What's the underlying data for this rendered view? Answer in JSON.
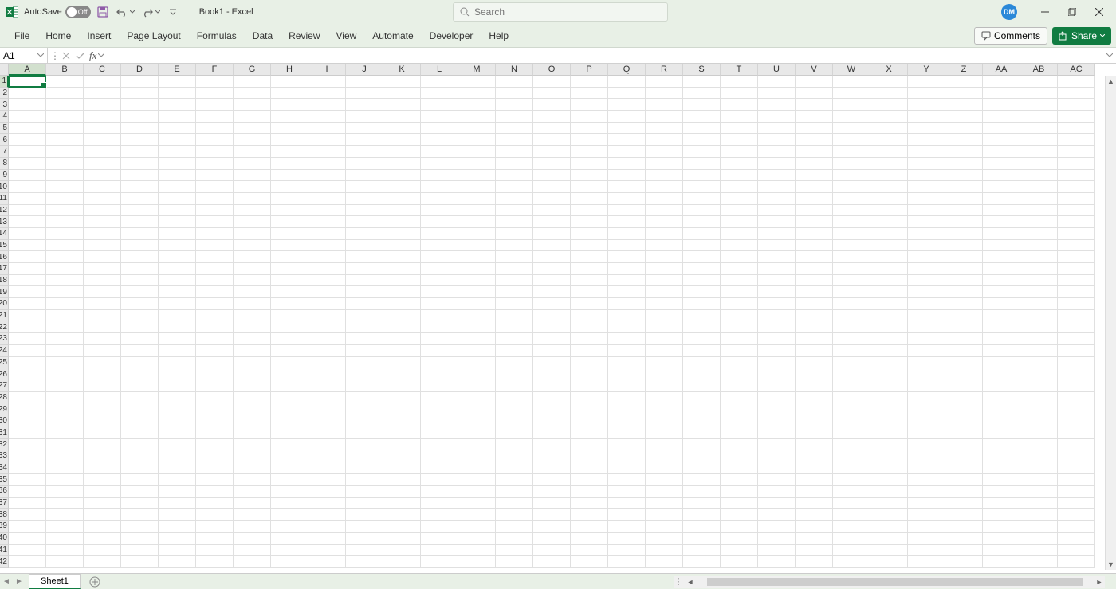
{
  "titlebar": {
    "autosave_label": "AutoSave",
    "autosave_state": "Off",
    "document_title": "Book1  -  Excel",
    "search_placeholder": "Search",
    "user_initials": "DM"
  },
  "ribbon": {
    "tabs": [
      "File",
      "Home",
      "Insert",
      "Page Layout",
      "Formulas",
      "Data",
      "Review",
      "View",
      "Automate",
      "Developer",
      "Help"
    ],
    "comments_label": "Comments",
    "share_label": "Share"
  },
  "formula_bar": {
    "name_box_value": "A1",
    "fx_label": "fx",
    "formula_value": ""
  },
  "grid": {
    "columns": [
      "A",
      "B",
      "C",
      "D",
      "E",
      "F",
      "G",
      "H",
      "I",
      "J",
      "K",
      "L",
      "M",
      "N",
      "O",
      "P",
      "Q",
      "R",
      "S",
      "T",
      "U",
      "V",
      "W",
      "X",
      "Y",
      "Z",
      "AA",
      "AB",
      "AC"
    ],
    "row_count": 42,
    "active_cell": "A1"
  },
  "sheets": {
    "active": "Sheet1",
    "tabs": [
      "Sheet1"
    ]
  }
}
